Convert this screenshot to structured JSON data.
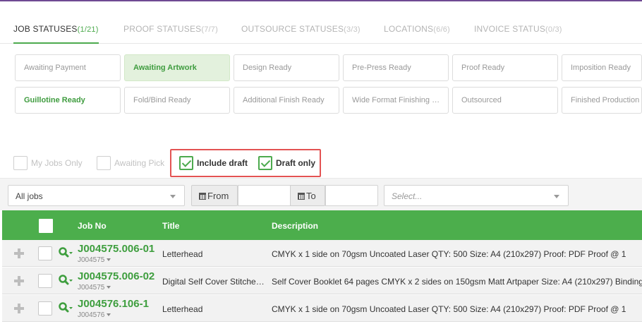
{
  "colors": {
    "accent": "#4daa4e",
    "header_bg": "#4cae4c",
    "highlight_border": "#e35353",
    "top_line": "#6f4a93"
  },
  "tabs": [
    {
      "label": "JOB STATUSES",
      "count": "(1/21)"
    },
    {
      "label": "PROOF STATUSES",
      "count": "(7/7)"
    },
    {
      "label": "OUTSOURCE STATUSES",
      "count": "(3/3)"
    },
    {
      "label": "LOCATIONS",
      "count": "(6/6)"
    },
    {
      "label": "INVOICE STATUS",
      "count": "(0/3)"
    }
  ],
  "statuses": [
    "Awaiting Payment",
    "Awaiting Artwork",
    "Design Ready",
    "Pre-Press Ready",
    "Proof Ready",
    "Imposition Ready",
    "Guillotine Ready",
    "Fold/Bind Ready",
    "Additional Finish Ready",
    "Wide Format Finishing Ready",
    "Outsourced",
    "Finished Production"
  ],
  "filters": {
    "my_jobs_only": "My Jobs Only",
    "awaiting_pick": "Awaiting Pick",
    "include_draft": "Include draft",
    "draft_only": "Draft only"
  },
  "toolbar": {
    "jobs_select": "All jobs",
    "from_label": "From",
    "to_label": "To",
    "select_placeholder": "Select..."
  },
  "table": {
    "columns": {
      "job_no": "Job No",
      "title": "Title",
      "description": "Description"
    },
    "rows": [
      {
        "job_no": "J004575.006-01",
        "parent": "J004575",
        "title": "Letterhead",
        "description": "CMYK x 1 side on 70gsm Uncoated Laser QTY: 500 Size: A4 (210x297) Proof: PDF Proof @ 1"
      },
      {
        "job_no": "J004575.006-02",
        "parent": "J004575",
        "title": "Digital Self Cover Stitched Booklet",
        "description": "Self Cover Booklet 64 pages CMYK x 2 sides on 150gsm Matt Artpaper Size: A4 (210x297) Binding"
      },
      {
        "job_no": "J004576.106-1",
        "parent": "J004576",
        "title": "Letterhead",
        "description": "CMYK x 1 side on 70gsm Uncoated Laser QTY: 500 Size: A4 (210x297) Proof: PDF Proof @ 1"
      }
    ]
  }
}
